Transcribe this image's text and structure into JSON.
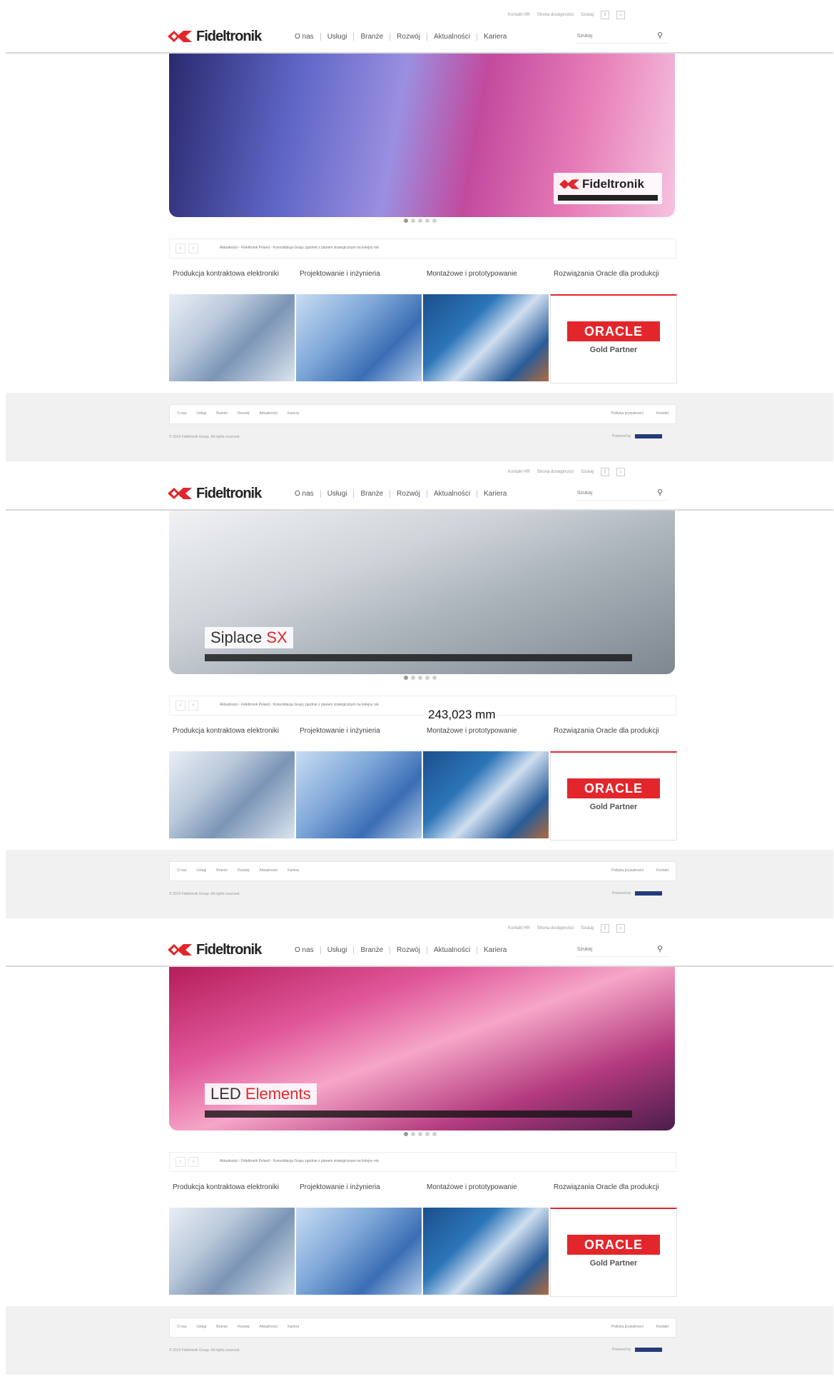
{
  "brand": {
    "logo_text": "Fideltronik",
    "accent": "#e3262b"
  },
  "top_util": [
    "Kontakt HR",
    "Strona dostępności",
    "Szukaj"
  ],
  "nav": [
    "O nas",
    "Usługi",
    "Branże",
    "Rozwój",
    "Aktualności",
    "Kariera"
  ],
  "search": {
    "placeholder": "Szukaj"
  },
  "slides": [
    {
      "title_a": "",
      "title_b": ""
    },
    {
      "title_a": "Siplace ",
      "title_b": "SX"
    },
    {
      "title_a": "LED",
      "title_b": " Elements"
    }
  ],
  "ticker_text": "Aktualności - Fideltronik Poland - Konsolidacja Grupy zgodnie z planem strategicznym na kolejny rok",
  "tiles": [
    {
      "label": "Produkcja kontraktowa elektroniki"
    },
    {
      "label": "Projektowanie i inżynieria"
    },
    {
      "label": "Montażowe i prototypowanie"
    },
    {
      "label": "Rozwiązania Oracle dla produkcji"
    }
  ],
  "oracle": {
    "name": "ORACLE",
    "tier": "Gold Partner"
  },
  "footer": {
    "links": [
      "O nas",
      "Usługi",
      "Branże",
      "Rozwój",
      "Aktualności",
      "Kariera"
    ],
    "right": [
      "Polityka prywatności",
      "Kontakt"
    ],
    "copyright": "© 2014 Fideltronik Group. All rights reserved.",
    "powered": "Powered by"
  },
  "measurement": "243,023 mm"
}
